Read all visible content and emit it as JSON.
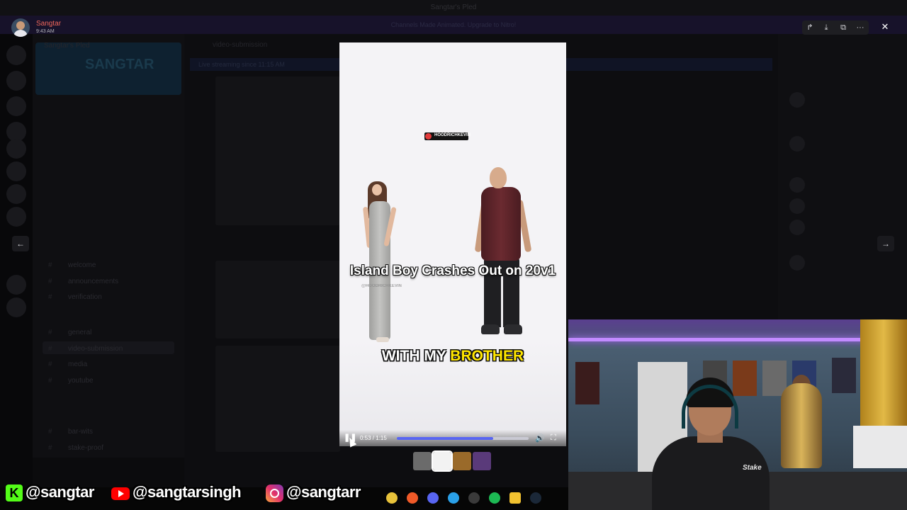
{
  "background_app": {
    "window_title": "Sangtar's Pled",
    "notice": "Channels Made Animated. Upgrade to Nitro!",
    "server_name": "Sangtar's Pled",
    "server_banner": "SANGTAR",
    "channel_header": "video-submission",
    "chat_banner": "Live streaming since 11:15 AM",
    "channels": [
      "welcome",
      "announcements",
      "verification",
      "general",
      "video-submission",
      "media",
      "youtube",
      "bar-wits",
      "stake-proof"
    ]
  },
  "viewer": {
    "user": "Sangtar",
    "time": "9:43 AM",
    "toolbar": {
      "forward": "↱",
      "download": "⤓",
      "open": "⧉",
      "more": "···"
    },
    "close": "✕",
    "prev": "←",
    "next": "→"
  },
  "video": {
    "watermark": "HOODRICHKEVIN",
    "watermark_small": "@HOODRICHKEVIN",
    "caption_title": "Island Boy Crashes Out on 20v1",
    "caption_lyric_pre": "WITH MY ",
    "caption_lyric_highlight": "BROTHER",
    "time_display": "0:53 / 1:15",
    "progress": 0.73,
    "pause_icon": "❚❚",
    "volume_icon": "🔊",
    "fullscreen_icon": "⛶"
  },
  "thumbnails": [
    {
      "color": "#6b6b6b",
      "active": false
    },
    {
      "color": "#f2f2f2",
      "active": true
    },
    {
      "color": "#9a6a2a",
      "active": false
    },
    {
      "color": "#5a3a7a",
      "active": false
    }
  ],
  "webcam": {
    "shirt_text": "Stake"
  },
  "socials": {
    "kick_letter": "K",
    "kick_handle": "@sangtar",
    "youtube_handle": "@sangtarsingh",
    "instagram_handle": "@sangtarr"
  }
}
